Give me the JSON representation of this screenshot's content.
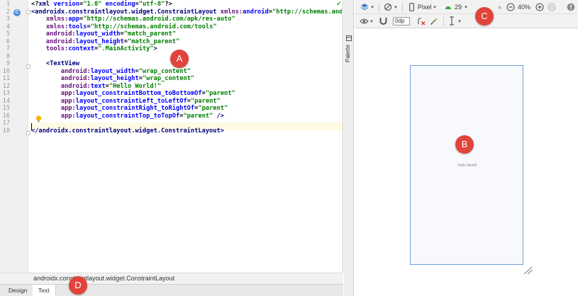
{
  "editor": {
    "line_numbers": [
      "1",
      "2",
      "3",
      "4",
      "5",
      "6",
      "7",
      "8",
      "9",
      "10",
      "11",
      "12",
      "13",
      "14",
      "15",
      "16",
      "17",
      "18"
    ],
    "lines": [
      [
        {
          "c": "p",
          "t": "<?"
        },
        {
          "c": "t",
          "t": "xml "
        },
        {
          "c": "at",
          "t": "version"
        },
        {
          "c": "p",
          "t": "="
        },
        {
          "c": "v",
          "t": "\"1.0\" "
        },
        {
          "c": "at",
          "t": "encoding"
        },
        {
          "c": "p",
          "t": "="
        },
        {
          "c": "v",
          "t": "\"utf-8\""
        },
        {
          "c": "p",
          "t": "?>"
        }
      ],
      [
        {
          "c": "t",
          "t": "<androidx.constraintlayout.widget.ConstraintLayout "
        },
        {
          "c": "ns",
          "t": "xmlns:"
        },
        {
          "c": "at",
          "t": "android"
        },
        {
          "c": "p",
          "t": "="
        },
        {
          "c": "v",
          "t": "\"http://schemas.android"
        }
      ],
      [
        {
          "c": "p",
          "t": "    "
        },
        {
          "c": "ns",
          "t": "xmlns:"
        },
        {
          "c": "at",
          "t": "app"
        },
        {
          "c": "p",
          "t": "="
        },
        {
          "c": "v",
          "t": "\"http://schemas.android.com/apk/res-auto\""
        }
      ],
      [
        {
          "c": "p",
          "t": "    "
        },
        {
          "c": "ns",
          "t": "xmlns:"
        },
        {
          "c": "at",
          "t": "tools"
        },
        {
          "c": "p",
          "t": "="
        },
        {
          "c": "v",
          "t": "\"http://schemas.android.com/tools\""
        }
      ],
      [
        {
          "c": "p",
          "t": "    "
        },
        {
          "c": "ns",
          "t": "android:"
        },
        {
          "c": "at",
          "t": "layout_width"
        },
        {
          "c": "p",
          "t": "="
        },
        {
          "c": "v",
          "t": "\"match_parent\""
        }
      ],
      [
        {
          "c": "p",
          "t": "    "
        },
        {
          "c": "ns",
          "t": "android:"
        },
        {
          "c": "at",
          "t": "layout_height"
        },
        {
          "c": "p",
          "t": "="
        },
        {
          "c": "v",
          "t": "\"match_parent\""
        }
      ],
      [
        {
          "c": "p",
          "t": "    "
        },
        {
          "c": "ns",
          "t": "tools:"
        },
        {
          "c": "at",
          "t": "context"
        },
        {
          "c": "p",
          "t": "="
        },
        {
          "c": "v",
          "t": "\".MainActivity\""
        },
        {
          "c": "t",
          "t": ">"
        }
      ],
      [],
      [
        {
          "c": "p",
          "t": "    "
        },
        {
          "c": "t",
          "t": "<TextView"
        }
      ],
      [
        {
          "c": "p",
          "t": "        "
        },
        {
          "c": "ns",
          "t": "android:"
        },
        {
          "c": "at",
          "t": "layout_width"
        },
        {
          "c": "p",
          "t": "="
        },
        {
          "c": "v",
          "t": "\"wrap_content\""
        }
      ],
      [
        {
          "c": "p",
          "t": "        "
        },
        {
          "c": "ns",
          "t": "android:"
        },
        {
          "c": "at",
          "t": "layout_height"
        },
        {
          "c": "p",
          "t": "="
        },
        {
          "c": "v",
          "t": "\"wrap_content\""
        }
      ],
      [
        {
          "c": "p",
          "t": "        "
        },
        {
          "c": "ns",
          "t": "android:"
        },
        {
          "c": "at",
          "t": "text"
        },
        {
          "c": "p",
          "t": "="
        },
        {
          "c": "v",
          "t": "\"Hello World!\""
        }
      ],
      [
        {
          "c": "p",
          "t": "        "
        },
        {
          "c": "ns",
          "t": "app:"
        },
        {
          "c": "at",
          "t": "layout_constraintBottom_toBottomOf"
        },
        {
          "c": "p",
          "t": "="
        },
        {
          "c": "v",
          "t": "\"parent\""
        }
      ],
      [
        {
          "c": "p",
          "t": "        "
        },
        {
          "c": "ns",
          "t": "app:"
        },
        {
          "c": "at",
          "t": "layout_constraintLeft_toLeftOf"
        },
        {
          "c": "p",
          "t": "="
        },
        {
          "c": "v",
          "t": "\"parent\""
        }
      ],
      [
        {
          "c": "p",
          "t": "        "
        },
        {
          "c": "ns",
          "t": "app:"
        },
        {
          "c": "at",
          "t": "layout_constraintRight_toRightOf"
        },
        {
          "c": "p",
          "t": "="
        },
        {
          "c": "v",
          "t": "\"parent\""
        }
      ],
      [
        {
          "c": "p",
          "t": "        "
        },
        {
          "c": "ns",
          "t": "app:"
        },
        {
          "c": "at",
          "t": "layout_constraintTop_toTopOf"
        },
        {
          "c": "p",
          "t": "="
        },
        {
          "c": "v",
          "t": "\"parent\" "
        },
        {
          "c": "t",
          "t": "/>"
        }
      ],
      [],
      [
        {
          "c": "t",
          "t": "</androidx.constraintlayout.widget.ConstraintLayout>"
        }
      ]
    ],
    "breadcrumb": "androidx.constraintlayout.widget.ConstraintLayout",
    "tabs": [
      "Design",
      "Text"
    ],
    "active_tab": "Text"
  },
  "palette": {
    "label": "Palette"
  },
  "design_toolbar": {
    "device": "Pixel",
    "api_level": "29",
    "zoom": "40%",
    "margin": "0dp"
  },
  "preview": {
    "text": "Hello World!"
  },
  "markers": {
    "a": "A",
    "b": "B",
    "c": "C",
    "d": "D"
  },
  "colors": {
    "marker": "#e0443b",
    "frame": "#6fa0d8",
    "api_icon": "#3ca53c"
  }
}
